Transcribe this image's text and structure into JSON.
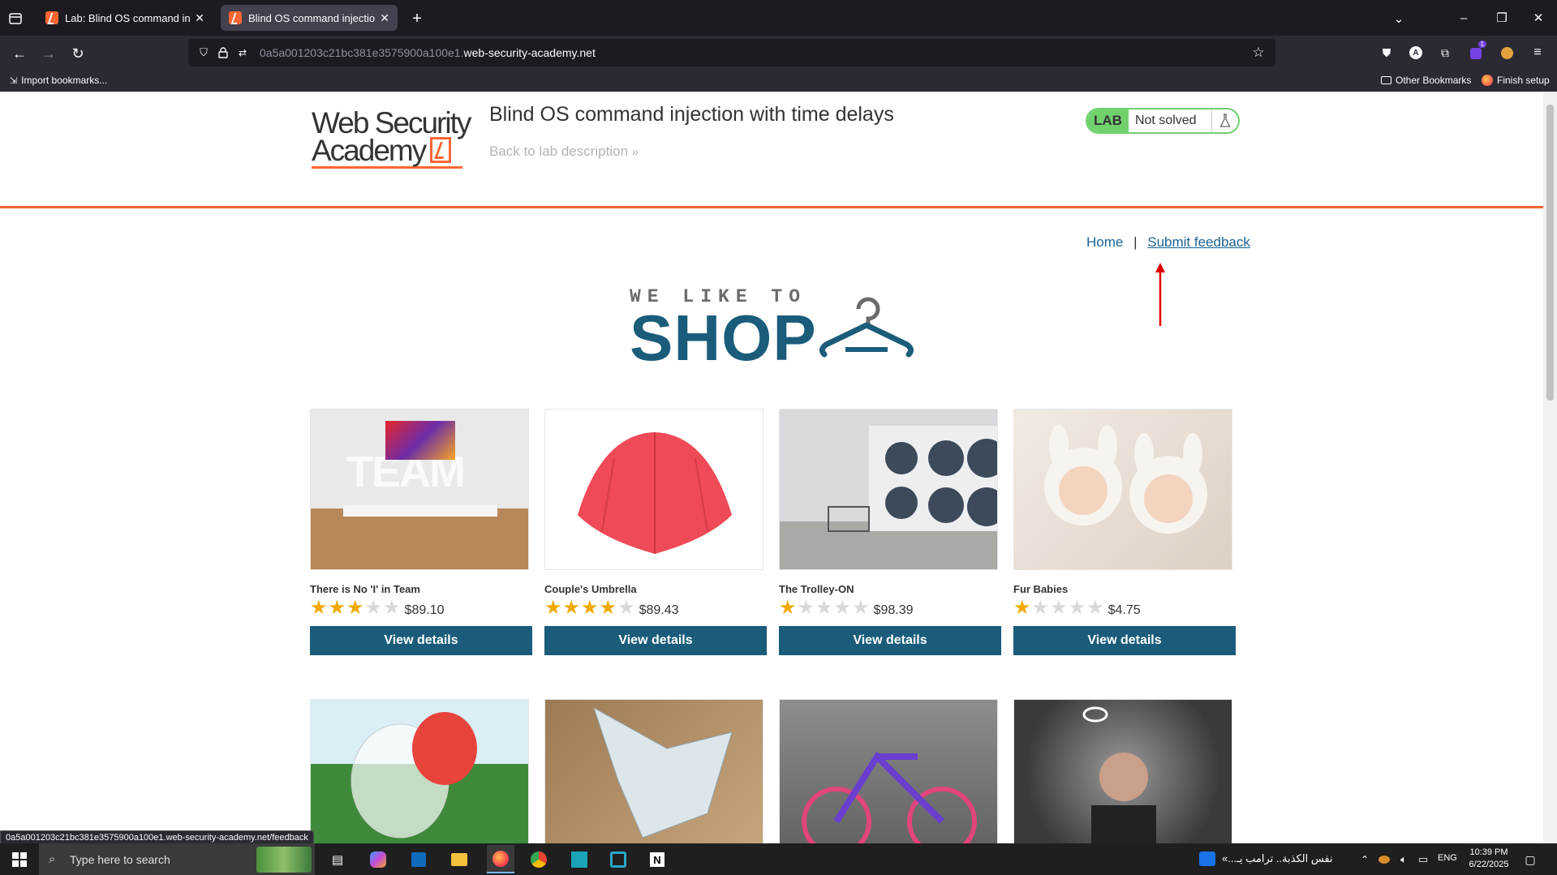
{
  "browser": {
    "tabs": [
      {
        "title": "Lab: Blind OS command injecti",
        "active": false
      },
      {
        "title": "Blind OS command injection w",
        "active": true
      }
    ],
    "url_prefix": "0a5a001203c21bc381e3575900a100e1.",
    "url_domain": "web-security-academy.net",
    "bookmarks": {
      "import": "Import bookmarks...",
      "other": "Other Bookmarks",
      "finish": "Finish setup"
    },
    "status_url": "0a5a001203c21bc381e3575900a100e1.web-security-academy.net/feedback",
    "extension_badge": "1"
  },
  "header": {
    "logo_line1": "Web Security",
    "logo_line2": "Academy",
    "lab_title": "Blind OS command injection with time delays",
    "back_link": "Back to lab description",
    "lab_tag": "LAB",
    "lab_status": "Not solved"
  },
  "nav": {
    "home": "Home",
    "separator": "|",
    "submit_feedback": "Submit feedback"
  },
  "banner": {
    "small": "WE LIKE TO",
    "big": "SHOP"
  },
  "products": [
    {
      "name": "There is No 'I' in Team",
      "stars": 3,
      "price": "$89.10",
      "button": "View details",
      "image": "team-image"
    },
    {
      "name": "Couple's Umbrella",
      "stars": 4,
      "price": "$89.43",
      "button": "View details",
      "image": "umbrella-image"
    },
    {
      "name": "The Trolley-ON",
      "stars": 1,
      "price": "$98.39",
      "button": "View details",
      "image": "laundry-image"
    },
    {
      "name": "Fur Babies",
      "stars": 1,
      "price": "$4.75",
      "button": "View details",
      "image": "babies-image"
    },
    {
      "image": "bubble-image"
    },
    {
      "image": "origami-image"
    },
    {
      "image": "bike-image"
    },
    {
      "image": "angel-image"
    }
  ],
  "colors": {
    "accent": "#ff6633",
    "brand_blue": "#1a5c7a",
    "lab_green": "#70d16d",
    "star": "#f2a900"
  },
  "taskbar": {
    "search_placeholder": "Type here to search",
    "news_text": "نفس الكذبة.. ترامب يـ...»",
    "language": "ENG",
    "time": "10:39 PM",
    "date": "6/22/2025"
  }
}
